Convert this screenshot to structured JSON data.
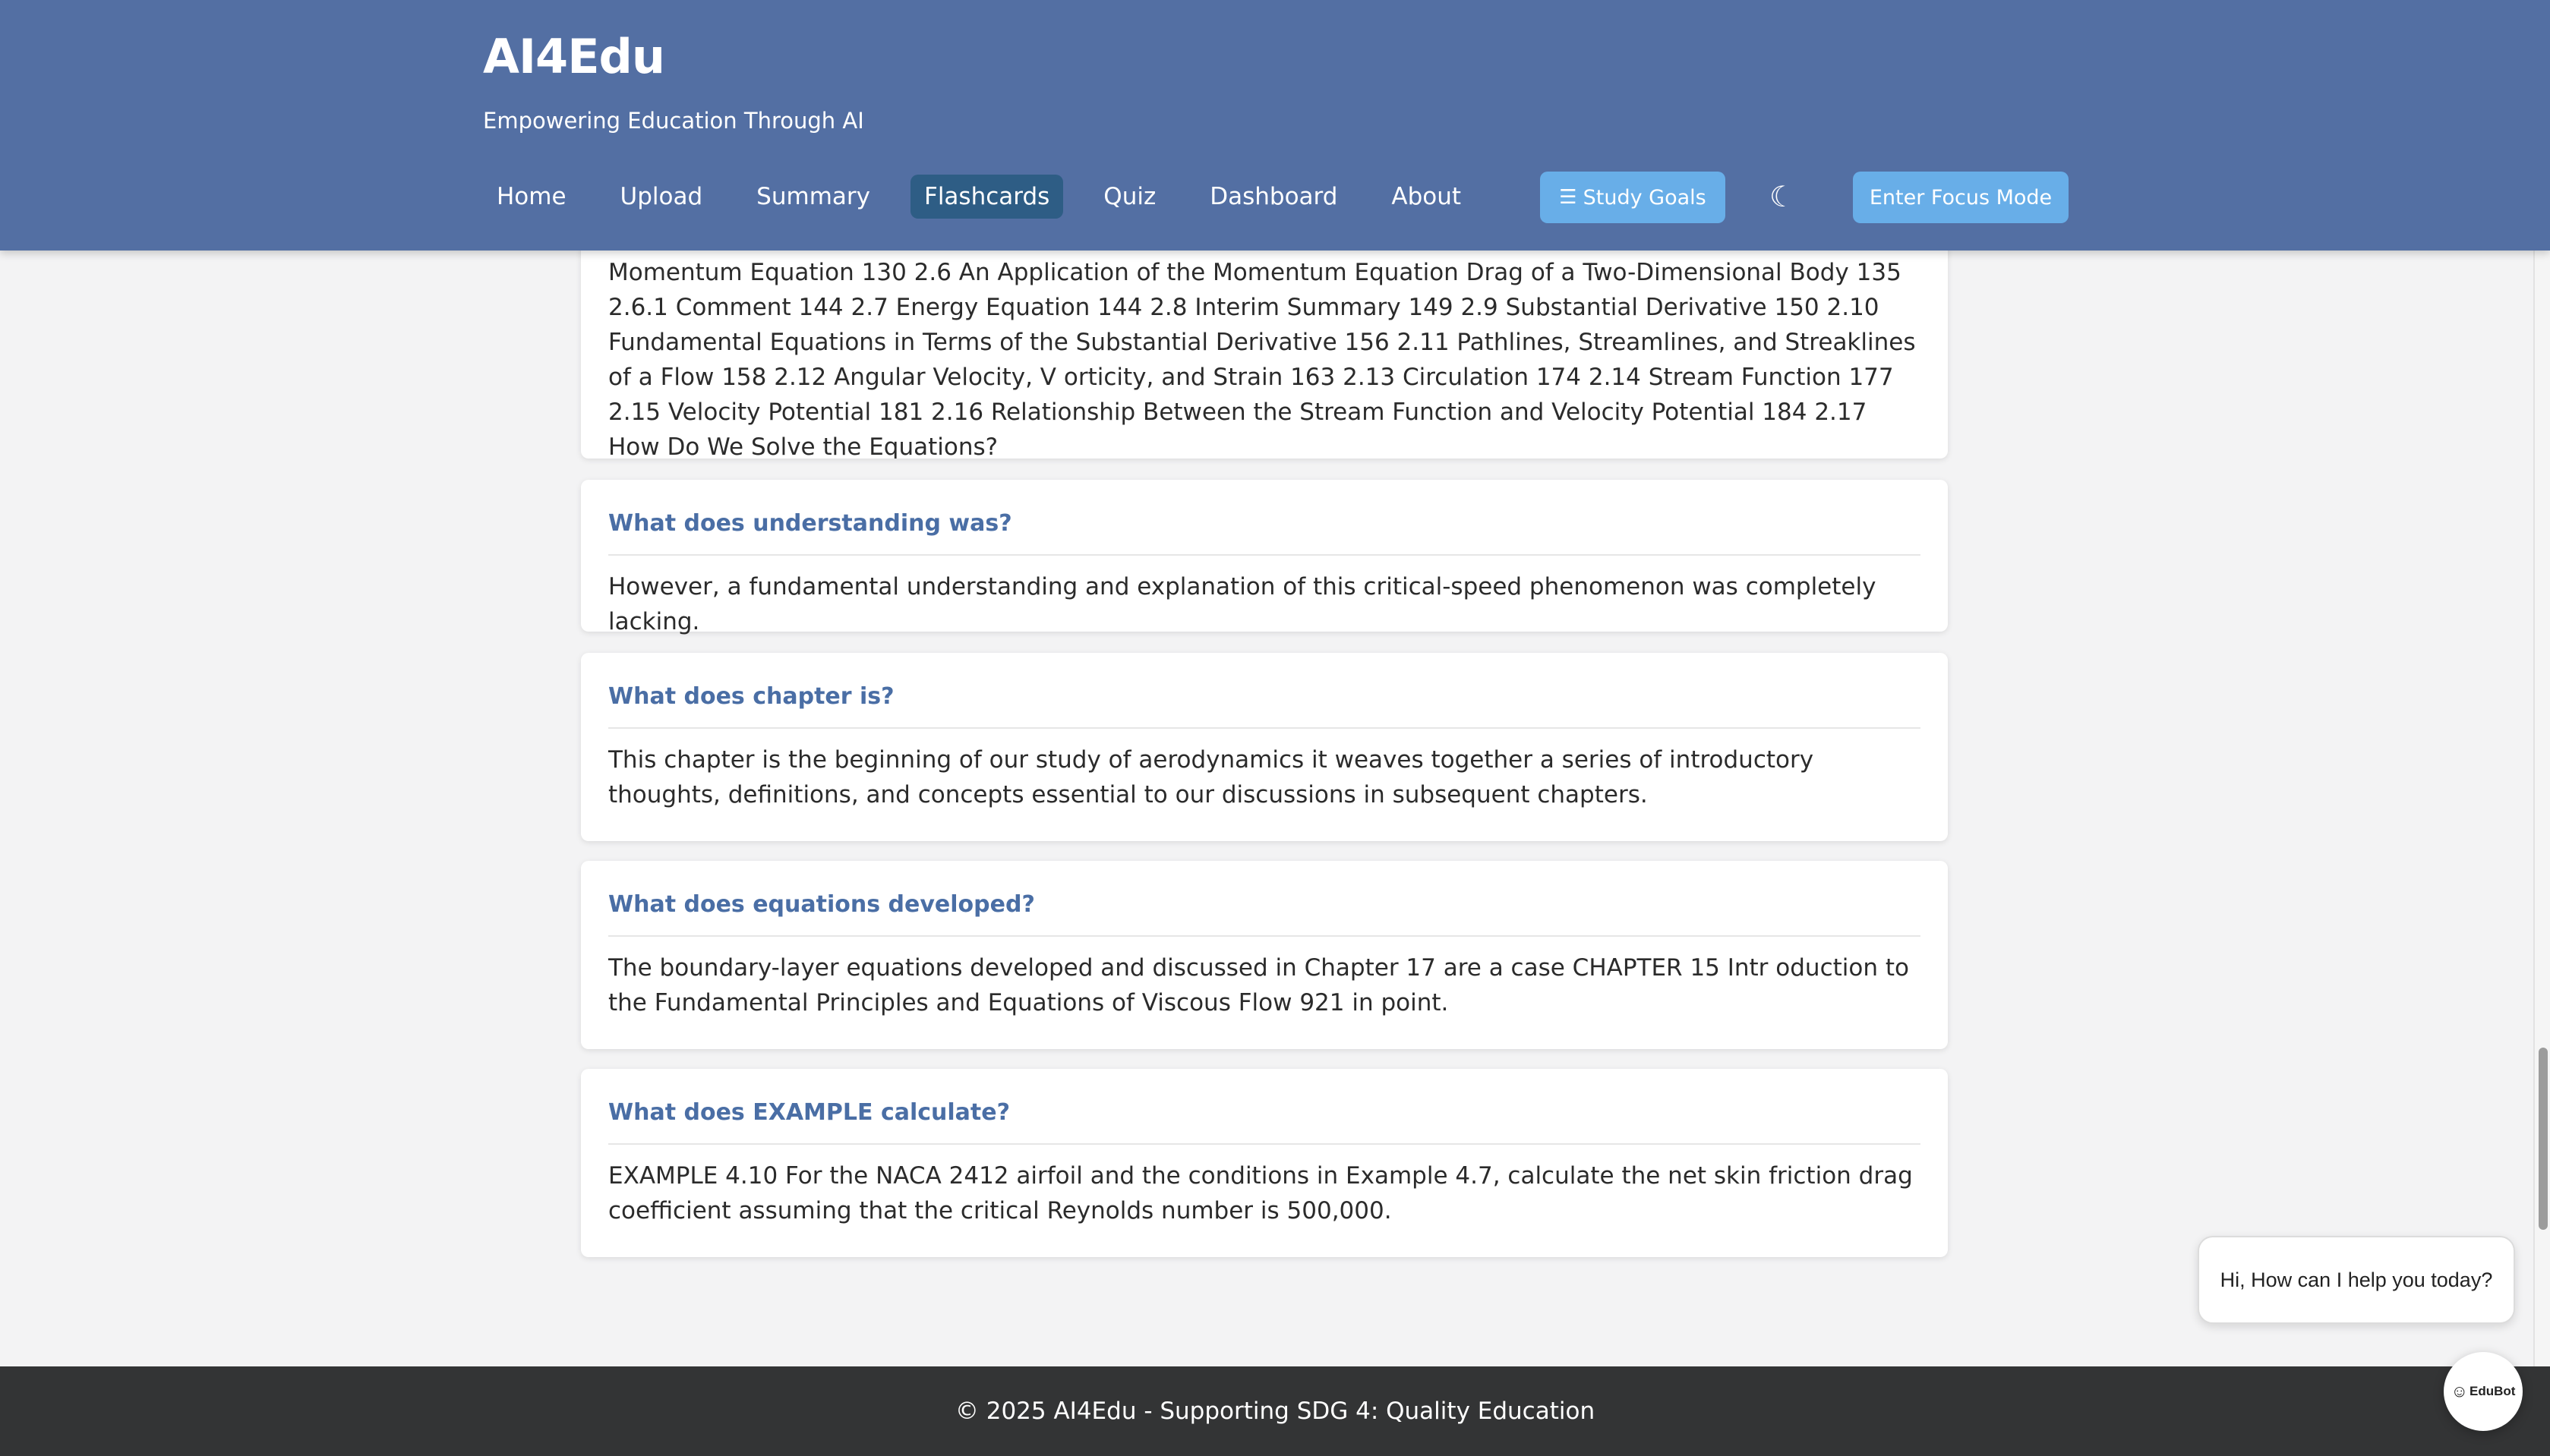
{
  "header": {
    "brand": "AI4Edu",
    "tagline": "Empowering Education Through AI",
    "nav": [
      "Home",
      "Upload",
      "Summary",
      "Flashcards",
      "Quiz",
      "Dashboard",
      "About"
    ],
    "active_nav": "Flashcards",
    "study_goals_label": "Study Goals",
    "study_goals_icon": "checklist-icon",
    "theme_icon": "moon-icon",
    "focus_mode_label": "Enter Focus Mode"
  },
  "flashcards": [
    {
      "question": "",
      "answer": "Momentum Equation 130 2.6 An Application of the Momentum Equation Drag of a Two-Dimensional Body 135 2.6.1 Comment 144 2.7 Energy Equation 144 2.8 Interim Summary 149 2.9 Substantial Derivative 150 2.10 Fundamental Equations in Terms of the Substantial Derivative 156 2.11 Pathlines, Streamlines, and Streaklines of a Flow 158 2.12 Angular Velocity, V orticity, and Strain 163 2.13 Circulation 174 2.14 Stream Function 177 2.15 Velocity Potential 181 2.16 Relationship Between the Stream Function and Velocity Potential 184 2.17 How Do We Solve the Equations?"
    },
    {
      "question": "What does understanding was?",
      "answer": "However, a fundamental understanding and explanation of this critical-speed phenomenon was completely lacking."
    },
    {
      "question": "What does chapter is?",
      "answer": "This chapter is the beginning of our study of aerodynamics it weaves together a series of introductory thoughts, definitions, and concepts essential to our discussions in subsequent chapters."
    },
    {
      "question": "What does equations developed?",
      "answer": "The boundary-layer equations developed and discussed in Chapter 17 are a case CHAPTER 15 Intr oduction to the Fundamental Principles and Equations of Viscous Flow 921 in point."
    },
    {
      "question": "What does EXAMPLE calculate?",
      "answer": "EXAMPLE 4.10 For the NACA 2412 airfoil and the conditions in Example 4.7, calculate the net skin friction drag coefficient assuming that the critical Reynolds number is 500,000."
    }
  ],
  "chatbot": {
    "greeting": "Hi, How can I help you today?",
    "launcher_label": "EduBot"
  },
  "footer": {
    "text": "© 2025 AI4Edu - Supporting SDG 4: Quality Education"
  }
}
